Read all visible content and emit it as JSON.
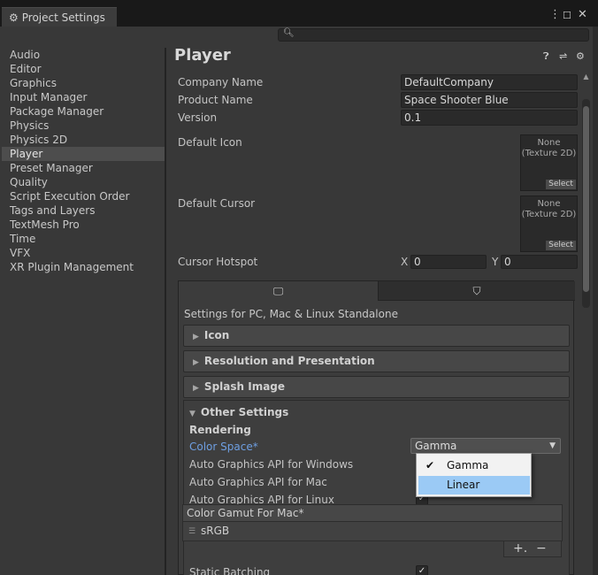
{
  "window": {
    "tab_title": "Project Settings",
    "menu_icon": "kebab-menu-icon",
    "maximize_icon": "maximize-icon",
    "close_icon": "close-icon"
  },
  "search": {
    "placeholder": "",
    "icon": "search-icon"
  },
  "sidebar": {
    "items": [
      {
        "label": "Audio"
      },
      {
        "label": "Editor"
      },
      {
        "label": "Graphics"
      },
      {
        "label": "Input Manager"
      },
      {
        "label": "Package Manager"
      },
      {
        "label": "Physics"
      },
      {
        "label": "Physics 2D"
      },
      {
        "label": "Player",
        "selected": true
      },
      {
        "label": "Preset Manager"
      },
      {
        "label": "Quality"
      },
      {
        "label": "Script Execution Order"
      },
      {
        "label": "Tags and Layers"
      },
      {
        "label": "TextMesh Pro"
      },
      {
        "label": "Time"
      },
      {
        "label": "VFX"
      },
      {
        "label": "XR Plugin Management"
      }
    ]
  },
  "player": {
    "title": "Player",
    "company_label": "Company Name",
    "company_value": "DefaultCompany",
    "product_label": "Product Name",
    "product_value": "Space Shooter Blue",
    "version_label": "Version",
    "version_value": "0.1",
    "icon_label": "Default Icon",
    "cursor_label": "Default Cursor",
    "texture_none": "None",
    "texture_type": "(Texture 2D)",
    "select_label": "Select",
    "hotspot_label": "Cursor Hotspot",
    "hotspot_x_label": "X",
    "hotspot_x_value": "0",
    "hotspot_y_label": "Y",
    "hotspot_y_value": "0"
  },
  "platform": {
    "title": "Settings for PC, Mac & Linux Standalone",
    "sections": {
      "icon": "Icon",
      "resolution": "Resolution and Presentation",
      "splash": "Splash Image",
      "other": "Other Settings"
    },
    "rendering_header": "Rendering",
    "color_space_label": "Color Space*",
    "color_space_value": "Gamma",
    "auto_windows_label": "Auto Graphics API  for Windows",
    "auto_mac_label": "Auto Graphics API  for Mac",
    "auto_linux_label": "Auto Graphics API  for Linux",
    "gamut_header": "Color Gamut For Mac*",
    "gamut_item": "sRGB",
    "add_label": "+.",
    "remove_label": "−",
    "static_batching_label": "Static Batching"
  },
  "popup": {
    "options": [
      "Gamma",
      "Linear"
    ],
    "checked": "Gamma",
    "highlighted": "Linear"
  },
  "colors": {
    "background": "#383838",
    "selection": "#4d4d4d",
    "accent_label": "#6e9fe2",
    "popup_highlight": "#9bcaf5"
  }
}
